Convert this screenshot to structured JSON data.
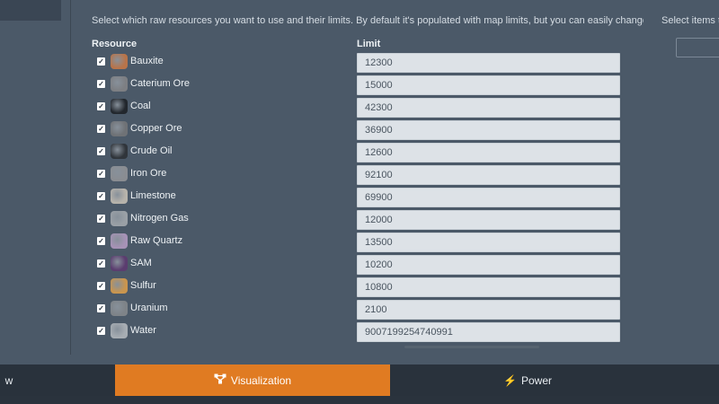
{
  "description": "Select which raw resources you want to use and their limits. By default it's populated with map limits, but you can easily change that.",
  "columns": {
    "resource": "Resource",
    "limit": "Limit"
  },
  "resources": [
    {
      "name": "Bauxite",
      "limit": "12300",
      "checked": true,
      "icon": "bauxite-icon",
      "color": "#b8744a"
    },
    {
      "name": "Caterium Ore",
      "limit": "15000",
      "checked": true,
      "icon": "caterium-ore-icon",
      "color": "#7d7f83"
    },
    {
      "name": "Coal",
      "limit": "42300",
      "checked": true,
      "icon": "coal-icon",
      "color": "#22272d"
    },
    {
      "name": "Copper Ore",
      "limit": "36900",
      "checked": true,
      "icon": "copper-ore-icon",
      "color": "#6f7276"
    },
    {
      "name": "Crude Oil",
      "limit": "12600",
      "checked": true,
      "icon": "crude-oil-icon",
      "color": "#30353b"
    },
    {
      "name": "Iron Ore",
      "limit": "92100",
      "checked": true,
      "icon": "iron-ore-icon",
      "color": "#8a8d92"
    },
    {
      "name": "Limestone",
      "limit": "69900",
      "checked": true,
      "icon": "limestone-icon",
      "color": "#b7b3ab"
    },
    {
      "name": "Nitrogen Gas",
      "limit": "12000",
      "checked": true,
      "icon": "nitrogen-gas-icon",
      "color": "#9aa0a6"
    },
    {
      "name": "Raw Quartz",
      "limit": "13500",
      "checked": true,
      "icon": "raw-quartz-icon",
      "color": "#a692b6"
    },
    {
      "name": "SAM",
      "limit": "10200",
      "checked": true,
      "icon": "sam-icon",
      "color": "#5b3d6f"
    },
    {
      "name": "Sulfur",
      "limit": "10800",
      "checked": true,
      "icon": "sulfur-icon",
      "color": "#c9954e"
    },
    {
      "name": "Uranium",
      "limit": "2100",
      "checked": true,
      "icon": "uranium-icon",
      "color": "#7e8388"
    },
    {
      "name": "Water",
      "limit": "9007199254740991",
      "checked": true,
      "icon": "water-icon",
      "color": "#a7adb3"
    }
  ],
  "right_panel": {
    "text": "Select items th"
  },
  "tabs": [
    {
      "label": "w",
      "icon": ""
    },
    {
      "label": "Visualization",
      "icon": "visualization-icon",
      "active": true
    },
    {
      "label": "Power",
      "icon": "power-icon"
    }
  ],
  "colors": {
    "accent": "#e07b22",
    "background": "#4b5968",
    "bar": "#29323c"
  }
}
